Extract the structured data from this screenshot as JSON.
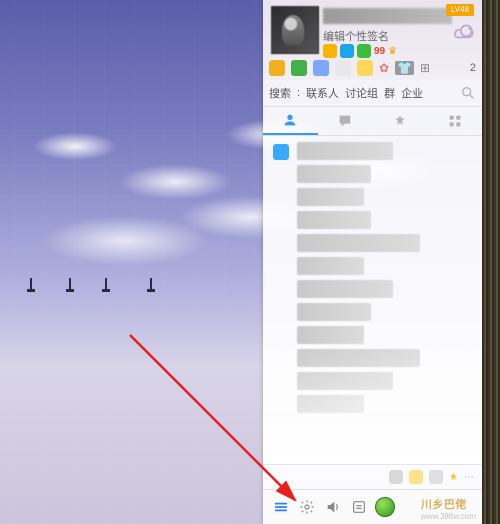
{
  "header": {
    "lv_badge": "LV48",
    "signature": "编辑个性签名",
    "svip_label": "99",
    "top_count": "2"
  },
  "search": {
    "label": "搜索",
    "seg_contacts": "联系人",
    "seg_groups": "讨论组",
    "seg_qun": "群",
    "seg_enterprise": "企业",
    "placeholder": ""
  },
  "bottom": {
    "menu": "menu",
    "settings": "settings",
    "sound": "sound",
    "apps": "apps"
  },
  "watermark": {
    "brand": "川乡巴佬",
    "url": "www.386w.com"
  }
}
